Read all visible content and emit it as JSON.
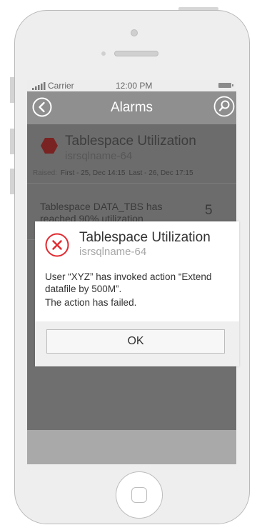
{
  "status_bar": {
    "carrier": "Carrier",
    "time": "12:00 PM"
  },
  "nav": {
    "title": "Alarms",
    "back_icon": "chevron-left-circle-icon",
    "search_icon": "search-circle-icon"
  },
  "alarm": {
    "title": "Tablespace Utilization",
    "host": "isrsqlname-64",
    "severity_color": "#7a2323",
    "raised_label": "Raised:",
    "first": "First - 25, Dec 14:15",
    "last": "Last - 26, Dec 17:15"
  },
  "list": {
    "items": [
      {
        "text": "Tablespace DATA_TBS has reached 90% utilization",
        "count": "5"
      }
    ]
  },
  "dialog": {
    "title": "Tablespace Utilization",
    "subtitle": "isrsqlname-64",
    "message": "User “XYZ” has invoked action “Extend datafile by 500M”.",
    "status": "The action has failed.",
    "ok_label": "OK",
    "icon": "error-x-icon",
    "icon_color": "#e2282f"
  }
}
